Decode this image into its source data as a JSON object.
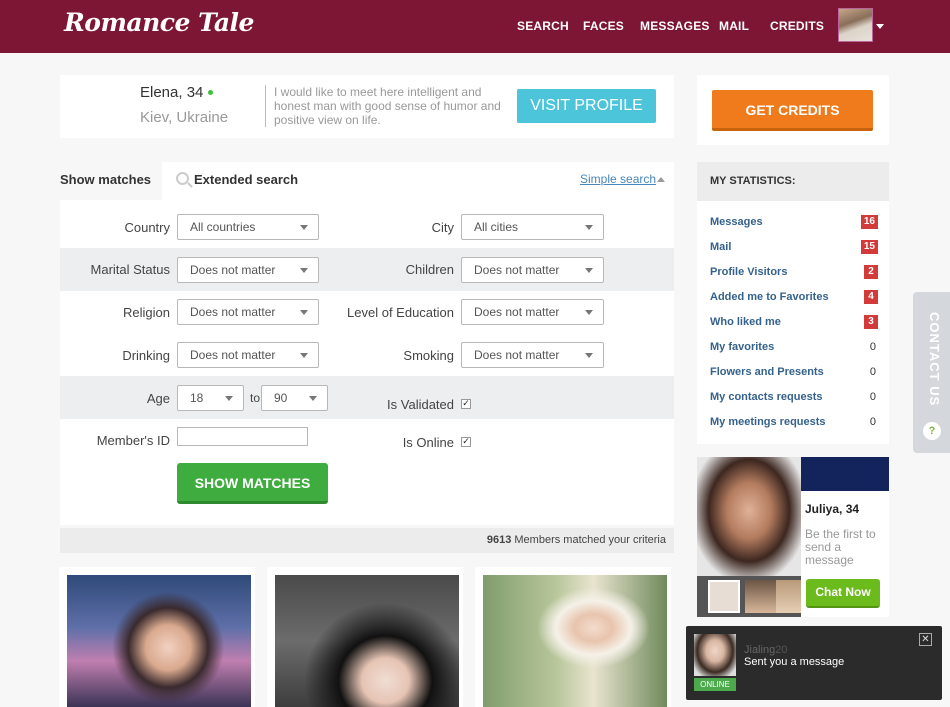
{
  "header": {
    "logo": "Romance Tale",
    "nav": [
      "SEARCH",
      "FACES",
      "MESSAGES",
      "MAIL",
      "CREDITS"
    ]
  },
  "profile": {
    "name_age": "Elena, 34",
    "location": "Kiev, Ukraine",
    "about": "I would like to meet here intelligent and honest man with good sense of humor and positive view on life.",
    "visit_label": "VISIT PROFILE"
  },
  "search": {
    "tab_show": "Show matches",
    "tab_extended": "Extended search",
    "simple_link": "Simple search",
    "country_label": "Country",
    "country_value": "All countries",
    "city_label": "City",
    "city_value": "All cities",
    "marital_label": "Marital Status",
    "marital_value": "Does not matter",
    "children_label": "Children",
    "children_value": "Does not matter",
    "religion_label": "Religion",
    "religion_value": "Does not matter",
    "education_label": "Level of Education",
    "education_value": "Does not matter",
    "drinking_label": "Drinking",
    "drinking_value": "Does not matter",
    "smoking_label": "Smoking",
    "smoking_value": "Does not matter",
    "age_label": "Age",
    "age_from": "18",
    "age_to_label": "to",
    "age_to": "90",
    "validated_label": "Is Validated",
    "validated_checked": true,
    "member_id_label": "Member's ID",
    "member_id_value": "",
    "online_label": "Is Online",
    "online_checked": true,
    "show_button": "SHOW MATCHES"
  },
  "results": {
    "count": "9613",
    "count_text": "Members matched your criteria"
  },
  "sidebar": {
    "credits_button": "GET CREDITS",
    "stats_title": "MY STATISTICS:",
    "stats": [
      {
        "label": "Messages",
        "value": "16",
        "highlight": true
      },
      {
        "label": "Mail",
        "value": "15",
        "highlight": true
      },
      {
        "label": "Profile Visitors",
        "value": "2",
        "highlight": true
      },
      {
        "label": "Added me to Favorites",
        "value": "4",
        "highlight": true
      },
      {
        "label": "Who liked me",
        "value": "3",
        "highlight": true
      },
      {
        "label": "My favorites",
        "value": "0",
        "highlight": false
      },
      {
        "label": "Flowers and Presents",
        "value": "0",
        "highlight": false
      },
      {
        "label": "My contacts requests",
        "value": "0",
        "highlight": false
      },
      {
        "label": "My meetings requests",
        "value": "0",
        "highlight": false
      }
    ],
    "contact_tab": "CONTACT US",
    "promo_name": "Juliya, 34",
    "promo_text": "Be the first to send a message",
    "chat_button": "Chat Now"
  },
  "toast": {
    "name": "Jialing",
    "age": "20",
    "message": "Sent you a message",
    "status": "ONLINE"
  },
  "colors": {
    "header": "#7d1534",
    "visit": "#4cc4d9",
    "show": "#3eac3e",
    "credits": "#f07b1c",
    "badge": "#d33b3b",
    "chat": "#6cbb1c"
  }
}
